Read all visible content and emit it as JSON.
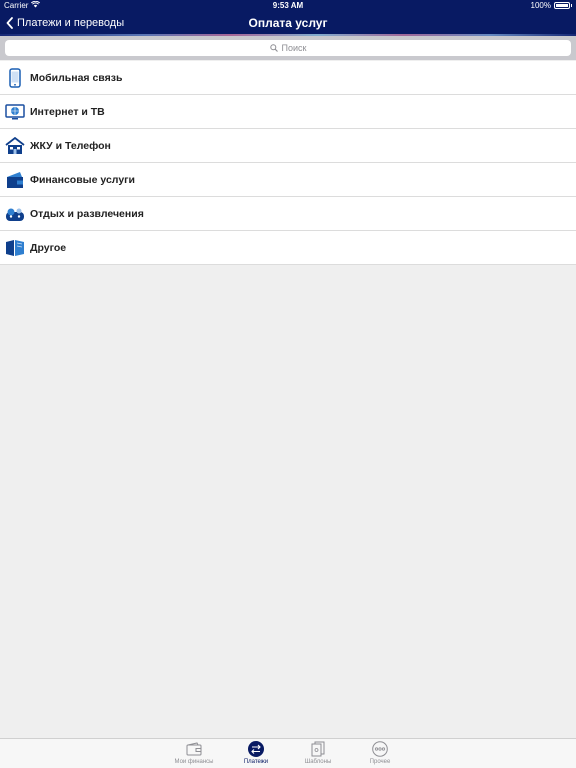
{
  "status_bar": {
    "carrier": "Carrier",
    "time": "9:53 AM",
    "battery": "100%"
  },
  "nav": {
    "back_label": "Платежи и переводы",
    "title": "Оплата услуг"
  },
  "search": {
    "placeholder": "Поиск"
  },
  "categories": [
    {
      "label": "Мобильная связь",
      "icon": "mobile-phone-icon"
    },
    {
      "label": "Интернет и ТВ",
      "icon": "tv-globe-icon"
    },
    {
      "label": "ЖКУ и Телефон",
      "icon": "house-phone-icon"
    },
    {
      "label": "Финансовые услуги",
      "icon": "wallet-card-icon"
    },
    {
      "label": "Отдых и развлечения",
      "icon": "leisure-gamepad-icon"
    },
    {
      "label": "Другое",
      "icon": "book-icon"
    }
  ],
  "tab_bar": {
    "tabs": [
      {
        "label": "Мои финансы",
        "icon": "wallet-icon",
        "active": false
      },
      {
        "label": "Платежи",
        "icon": "transfer-arrows-icon",
        "active": true
      },
      {
        "label": "Шаблоны",
        "icon": "templates-icon",
        "active": false
      },
      {
        "label": "Прочее",
        "icon": "more-dots-icon",
        "active": false
      }
    ]
  },
  "colors": {
    "brand": "#081a63",
    "accent": "#1a5fb4",
    "background": "#efefef"
  }
}
